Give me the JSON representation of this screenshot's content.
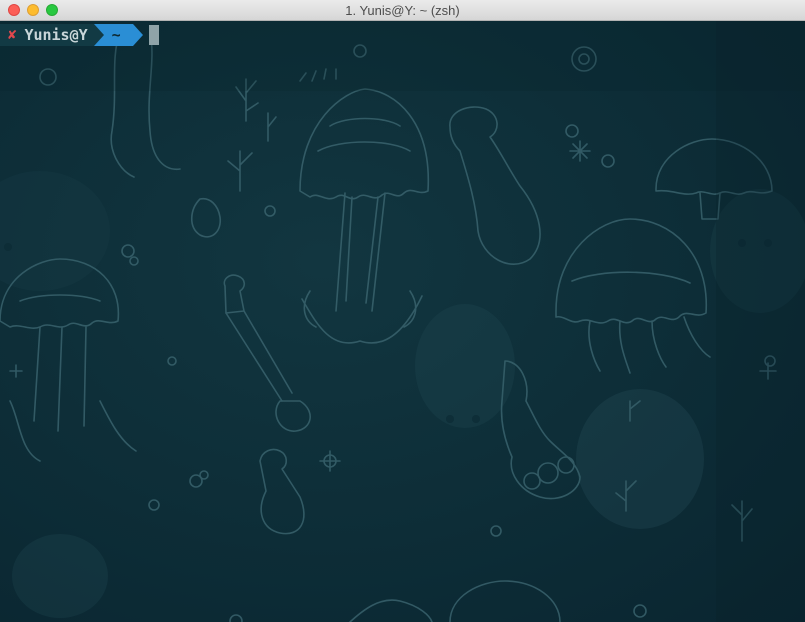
{
  "window": {
    "title": "1. Yunis@Y: ~ (zsh)"
  },
  "prompt": {
    "status_icon": "✘",
    "user_host": "Yunis@Y",
    "directory": "~"
  },
  "colors": {
    "background": "#0d2c36",
    "art_stroke": "#3f6a74",
    "user_segment": "#123a44",
    "dir_segment": "#2a8ed5",
    "error": "#e0484d",
    "cursor": "#8fa3a8"
  },
  "icons": [
    "close-icon",
    "minimize-icon",
    "zoom-icon",
    "error-x-icon",
    "cursor-block"
  ]
}
